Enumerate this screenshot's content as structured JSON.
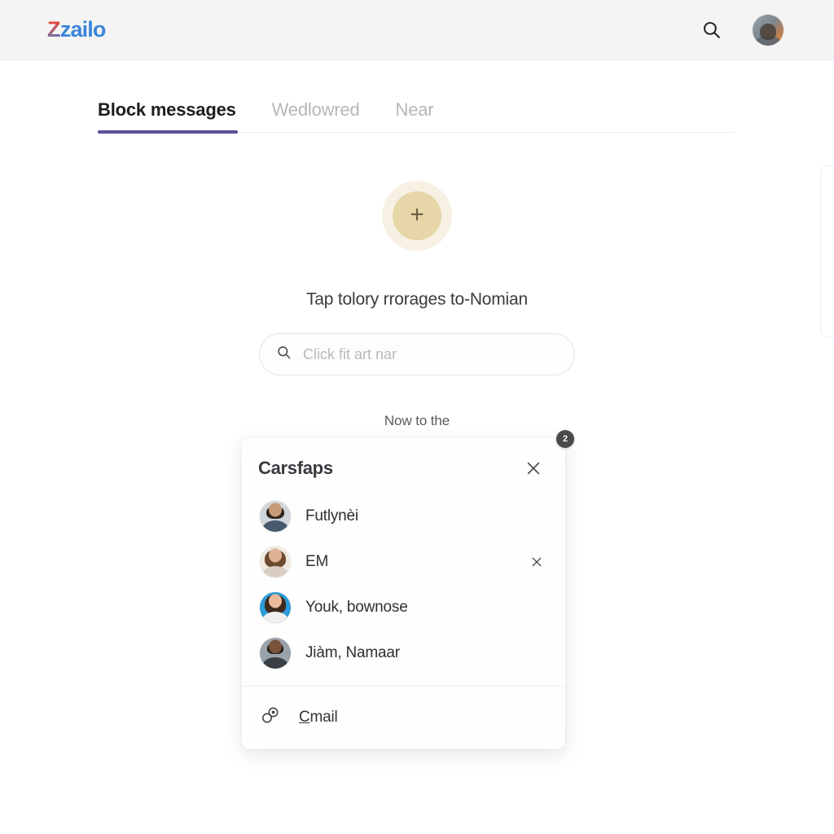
{
  "header": {
    "logo_lead": "Z",
    "logo_rest": "zailo",
    "search_icon": "search-icon",
    "avatar_icon": "user-avatar"
  },
  "tabs": [
    {
      "label": "Block messages",
      "active": true
    },
    {
      "label": "Wedlowred",
      "active": false
    },
    {
      "label": "Near",
      "active": false
    }
  ],
  "empty_state": {
    "add_icon": "plus-icon",
    "headline": "Tap tolory rrorages to-Nomian",
    "search": {
      "icon": "search-icon",
      "value": "",
      "placeholder": "Click fit art nar"
    },
    "subnote": "Now to the"
  },
  "card": {
    "badge": "2",
    "title": "Carsfaps",
    "close_icon": "close-icon",
    "items": [
      {
        "name": "Futlynèi",
        "avatar": "avatar-man-beard",
        "removable": false
      },
      {
        "name": "EM",
        "avatar": "avatar-woman-brown",
        "removable": true
      },
      {
        "name": "Youk, bownose",
        "avatar": "avatar-woman-blue",
        "removable": false
      },
      {
        "name": "Jiàm, Namaar",
        "avatar": "avatar-man-gray",
        "removable": false
      }
    ],
    "footer": {
      "icon": "link-rings-icon",
      "label_underlined": "C",
      "label_rest": "mail"
    }
  },
  "colors": {
    "accent_purple": "#5b4f9b",
    "logo_red": "#e04a3f",
    "logo_blue": "#3c86d8",
    "plus_ring": "#f6f1e3",
    "plus_fill": "#e7d6a7",
    "badge_bg": "#4a4a4d",
    "header_bg": "#f4f4f5"
  }
}
